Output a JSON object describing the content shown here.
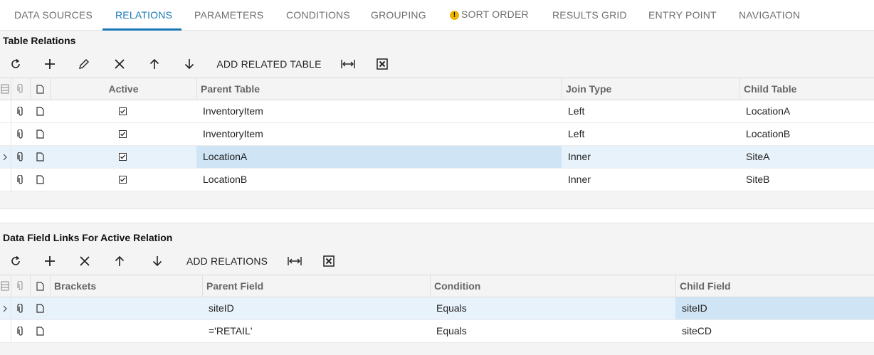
{
  "tabs": [
    {
      "label": "DATA SOURCES"
    },
    {
      "label": "RELATIONS"
    },
    {
      "label": "PARAMETERS"
    },
    {
      "label": "CONDITIONS"
    },
    {
      "label": "GROUPING"
    },
    {
      "label": "SORT ORDER"
    },
    {
      "label": "RESULTS GRID"
    },
    {
      "label": "ENTRY POINT"
    },
    {
      "label": "NAVIGATION"
    }
  ],
  "relations": {
    "title": "Table Relations",
    "add_button": "ADD RELATED TABLE",
    "headers": {
      "active": "Active",
      "parent": "Parent Table",
      "join": "Join Type",
      "child": "Child Table"
    },
    "rows": [
      {
        "active": true,
        "parent": "InventoryItem",
        "join": "Left",
        "child": "LocationA"
      },
      {
        "active": true,
        "parent": "InventoryItem",
        "join": "Left",
        "child": "LocationB"
      },
      {
        "active": true,
        "parent": "LocationA",
        "join": "Inner",
        "child": "SiteA"
      },
      {
        "active": true,
        "parent": "LocationB",
        "join": "Inner",
        "child": "SiteB"
      }
    ]
  },
  "links": {
    "title": "Data Field Links For Active Relation",
    "add_button": "ADD RELATIONS",
    "headers": {
      "brackets": "Brackets",
      "parent": "Parent Field",
      "condition": "Condition",
      "child": "Child Field"
    },
    "rows": [
      {
        "brackets": "",
        "parent": "siteID",
        "condition": "Equals",
        "child": "siteID"
      },
      {
        "brackets": "",
        "parent": "='RETAIL'",
        "condition": "Equals",
        "child": "siteCD"
      }
    ]
  },
  "colors": {
    "accent": "#1a78b6",
    "warning": "#f0b400",
    "selected_row": "#e8f2fb",
    "selected_cell": "#cfe4f5"
  }
}
